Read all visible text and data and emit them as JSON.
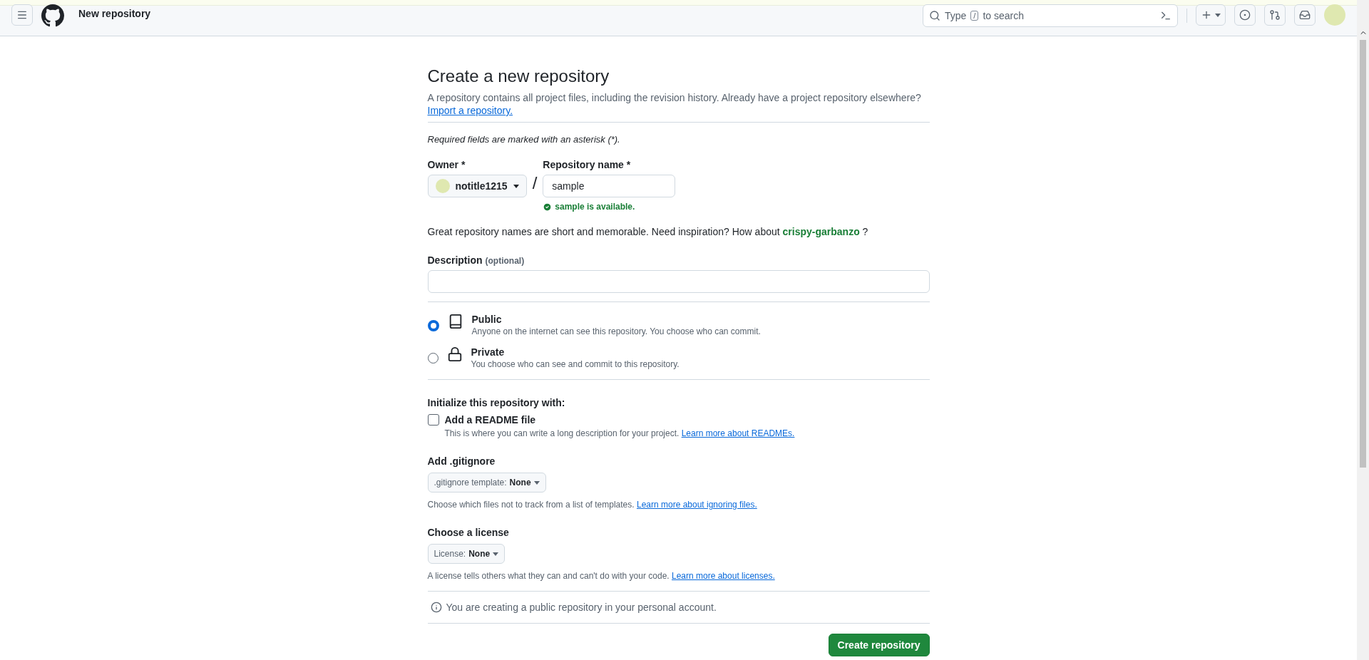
{
  "header": {
    "page_title": "New repository",
    "search": {
      "prefix": "Type",
      "key": "/",
      "suffix": "to search"
    }
  },
  "form": {
    "title": "Create a new repository",
    "intro": "A repository contains all project files, including the revision history. Already have a project repository elsewhere?",
    "import_link": "Import a repository.",
    "required_note": "Required fields are marked with an asterisk (*).",
    "owner": {
      "label": "Owner *",
      "value": "notitle1215"
    },
    "separator": "/",
    "repo_name": {
      "label": "Repository name *",
      "value": "sample",
      "status": "sample is available."
    },
    "suggestion": {
      "text": "Great repository names are short and memorable. Need inspiration? How about",
      "name": "crispy-garbanzo",
      "end": "?"
    },
    "description": {
      "label": "Description",
      "hint": "(optional)"
    },
    "visibility": [
      {
        "kind": "public",
        "label": "Public",
        "desc": "Anyone on the internet can see this repository. You choose who can commit.",
        "selected": true
      },
      {
        "kind": "private",
        "label": "Private",
        "desc": "You choose who can see and commit to this repository.",
        "selected": false
      }
    ],
    "init_title": "Initialize this repository with:",
    "readme": {
      "label": "Add a README file",
      "checked": false,
      "desc": "This is where you can write a long description for your project.",
      "link": "Learn more about READMEs."
    },
    "gitignore": {
      "title": "Add .gitignore",
      "prefix": ".gitignore template:",
      "value": "None",
      "desc": "Choose which files not to track from a list of templates.",
      "link": "Learn more about ignoring files."
    },
    "license": {
      "title": "Choose a license",
      "prefix": "License:",
      "value": "None",
      "desc": "A license tells others what they can and can't do with your code.",
      "link": "Learn more about licenses."
    },
    "notice": "You are creating a public repository in your personal account.",
    "submit": "Create repository"
  }
}
